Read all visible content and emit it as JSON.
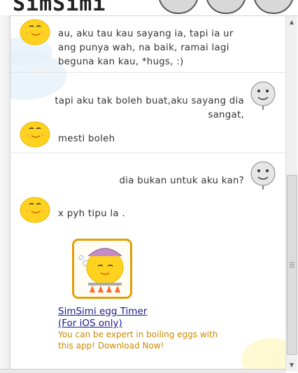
{
  "app": {
    "logo": "SimSimi"
  },
  "messages": [
    {
      "from": "simsimi",
      "text": "au, aku tau kau sayang ia, tapi ia ur ang punya wah, na baik, ramai lagi beguna kan kau, *hugs, :)"
    },
    {
      "from": "user",
      "text": "tapi aku tak boleh buat,aku sayang dia sangat,"
    },
    {
      "from": "simsimi",
      "text": "mesti boleh"
    },
    {
      "from": "user",
      "text": "dia bukan untuk aku kan?"
    },
    {
      "from": "simsimi",
      "text": "x pyh tipu la ."
    }
  ],
  "ad": {
    "title_line1": "SimSimi egg Timer",
    "title_line2": "(For iOS only)",
    "description": "You can be expert in boiling eggs with this app! Download Now!"
  },
  "colors": {
    "chick": "#ffd21f",
    "link": "#1a1a8c",
    "ad_text": "#c98a00",
    "ad_border": "#e79d00"
  },
  "icons": [
    "simsimi-chick-icon",
    "user-gray-face-icon",
    "egg-timer-app-icon",
    "scroll-up-arrow",
    "scroll-down-arrow"
  ]
}
